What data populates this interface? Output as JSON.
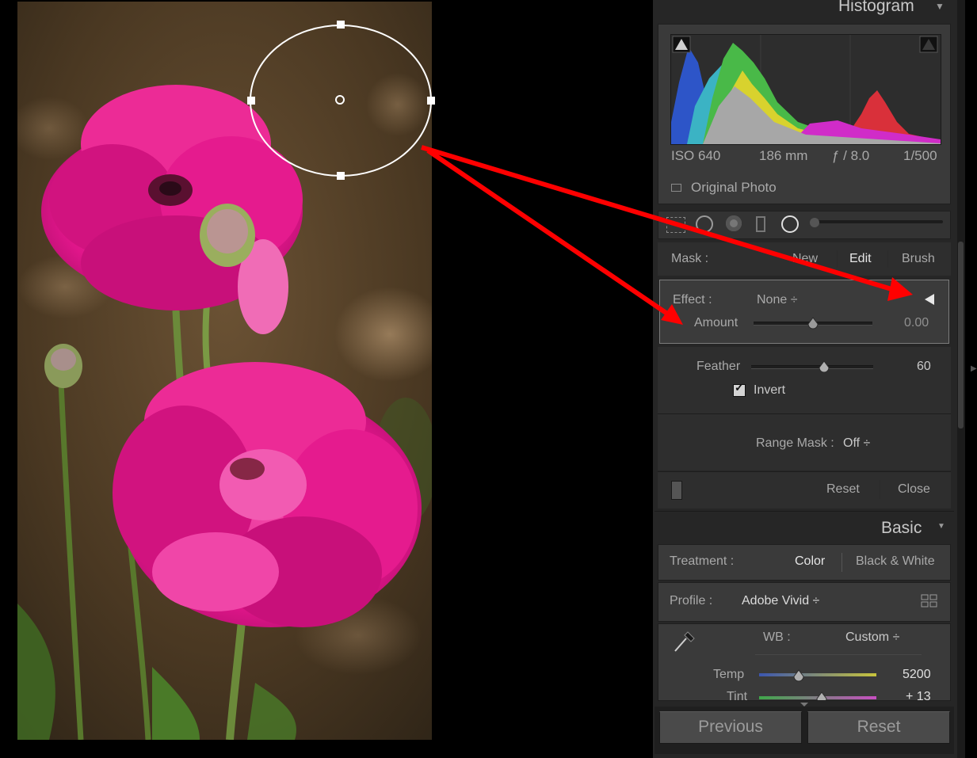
{
  "histogram": {
    "title": "Histogram",
    "exif": {
      "iso": "ISO 640",
      "focal": "186 mm",
      "aperture": "ƒ / 8.0",
      "shutter": "1/500"
    },
    "original_photo_label": "Original Photo"
  },
  "mask": {
    "label": "Mask :",
    "modes": [
      "New",
      "Edit",
      "Brush"
    ],
    "active_mode": "Edit"
  },
  "effect": {
    "label": "Effect :",
    "value": "None ÷",
    "amount_label": "Amount",
    "amount_value": "0.00"
  },
  "feather": {
    "label": "Feather",
    "value": "60"
  },
  "invert": {
    "label": "Invert",
    "checked": true
  },
  "range_mask": {
    "label": "Range Mask :",
    "value": "Off ÷"
  },
  "tool_footer": {
    "reset": "Reset",
    "close": "Close"
  },
  "basic": {
    "title": "Basic",
    "treatment_label": "Treatment :",
    "treatment_color": "Color",
    "treatment_bw": "Black & White",
    "profile_label": "Profile :",
    "profile_value": "Adobe Vivid ÷",
    "wb_label": "WB :",
    "wb_value": "Custom ÷",
    "temp_label": "Temp",
    "temp_value": "5200",
    "tint_label": "Tint",
    "tint_value": "+ 13"
  },
  "buttons": {
    "previous": "Previous",
    "reset": "Reset"
  },
  "colors": {
    "panel": "#262626",
    "annotation_arrow": "#ff0000",
    "flower": "#e0168a"
  }
}
